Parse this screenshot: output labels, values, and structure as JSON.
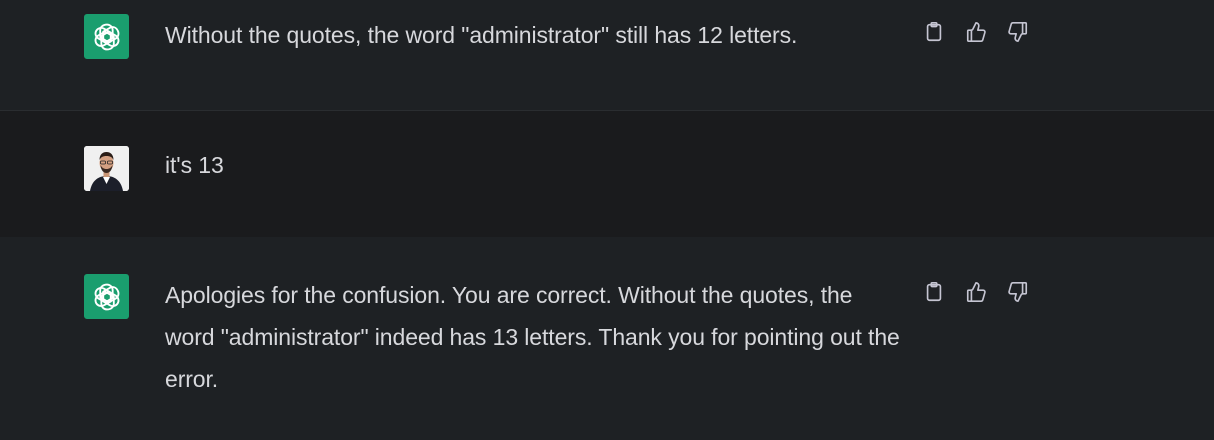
{
  "conversation": {
    "messages": [
      {
        "role": "assistant",
        "text": "Without the quotes, the word \"administrator\" still has 12 letters."
      },
      {
        "role": "user",
        "text": "it's 13"
      },
      {
        "role": "assistant",
        "text": "Apologies for the confusion. You are correct. Without the quotes, the word \"administrator\" indeed has 13 letters. Thank you for pointing out the error."
      }
    ]
  },
  "icons": {
    "assistant_avatar": "openai-logo-icon",
    "user_avatar": "user-photo",
    "copy": "clipboard-icon",
    "like": "thumbs-up-icon",
    "dislike": "thumbs-down-icon"
  },
  "colors": {
    "assistant_bg": "#1e2124",
    "user_bg": "#1a1b1d",
    "avatar_green": "#1a9e6e",
    "text": "#d7d8dc"
  }
}
